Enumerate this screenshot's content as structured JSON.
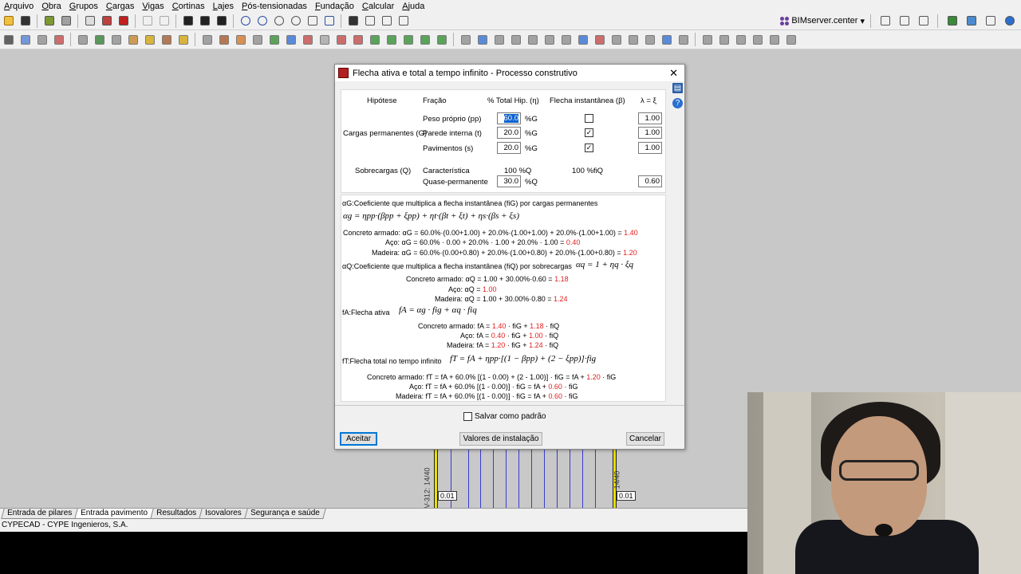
{
  "menu": [
    "Arquivo",
    "Obra",
    "Grupos",
    "Cargas",
    "Vigas",
    "Cortinas",
    "Lajes",
    "Pós-tensionadas",
    "Fundação",
    "Calcular",
    "Ajuda"
  ],
  "bimserver": {
    "label": "BIMserver.center"
  },
  "dialog": {
    "title": "Flecha ativa e total a tempo infinito - Processo construtivo",
    "headers": {
      "hipotese": "Hipótese",
      "fracao": "Fração",
      "total_hip": "% Total Hip. (η)",
      "flecha_inst": "Flecha instantânea (β)",
      "lambda": "λ = ξ"
    },
    "permanentes": {
      "group_label": "Cargas permanentes (G)",
      "rows": [
        {
          "label": "Peso próprio (pp)",
          "pct": "60.0",
          "unit": "%G",
          "checked": false,
          "lambda": "1.00"
        },
        {
          "label": "Parede interna (t)",
          "pct": "20.0",
          "unit": "%G",
          "checked": true,
          "lambda": "1.00"
        },
        {
          "label": "Pavimentos (s)",
          "pct": "20.0",
          "unit": "%G",
          "checked": true,
          "lambda": "1.00"
        }
      ]
    },
    "sobrecargas": {
      "group_label": "Sobrecargas (Q)",
      "caracteristica_label": "Característica",
      "caracteristica_pct": "100 %Q",
      "caracteristica_flecha": "100 %fiQ",
      "quase_label": "Quase-permanente",
      "quase_pct": "30.0",
      "quase_unit": "%Q",
      "quase_lambda": "0.60"
    },
    "formulas": {
      "ag_desc": "αG:Coeficiente que multiplica a flecha instantânea (fiG) por cargas permanentes",
      "ag_formula": "αg = ηpp·(βpp + ξpp) + ηt·(βt + ξt) + ηs·(βs + ξs)",
      "ag_concreto": {
        "prefix": "Concreto armado: αG = 60.0%·(0.00+1.00) + 20.0%·(1.00+1.00) + 20.0%·(1.00+1.00) = ",
        "value": "1.40"
      },
      "ag_aco": {
        "prefix": "Aço: αG = 60.0% · 0.00 + 20.0% · 1.00 + 20.0% · 1.00 = ",
        "value": "0.40"
      },
      "ag_madeira": {
        "prefix": "Madeira: αG = 60.0%·(0.00+0.80) + 20.0%·(1.00+0.80) + 20.0%·(1.00+0.80) = ",
        "value": "1.20"
      },
      "aq_desc": "αQ:Coeficiente que multiplica a flecha instantânea (fiQ) por sobrecargas",
      "aq_formula": "αq = 1 + ηq · ξq",
      "aq_concreto": {
        "prefix": "Concreto armado: αQ = 1.00 + 30.00%·0.60 = ",
        "value": "1.18"
      },
      "aq_aco": {
        "prefix": "Aço: αQ = ",
        "value": "1.00"
      },
      "aq_madeira": {
        "prefix": "Madeira: αQ = 1.00 + 30.00%·0.80 = ",
        "value": "1.24"
      },
      "fa_desc": "fA:Flecha ativa",
      "fa_formula": "fA = αg · fig + αq · fiq",
      "fa_concreto": {
        "prefix": "Concreto armado: fA = ",
        "v1": "1.40",
        "mid": " · fiG + ",
        "v2": "1.18",
        "suffix": " · fiQ"
      },
      "fa_aco": {
        "prefix": "Aço: fA = ",
        "v1": "0.40",
        "mid": " · fiG + ",
        "v2": "1.00",
        "suffix": " · fiQ"
      },
      "fa_madeira": {
        "prefix": "Madeira: fA = ",
        "v1": "1.20",
        "mid": " · fiG + ",
        "v2": "1.24",
        "suffix": " · fiQ"
      },
      "ft_desc": "fT:Flecha total no tempo infinito",
      "ft_formula": "fT = fA + ηpp·[(1 − βpp) + (2 − ξpp)]·fig",
      "ft_concreto": {
        "prefix": "Concreto armado: fT = fA + 60.0% [(1 - 0.00) + (2 - 1.00)] · fiG = fA + ",
        "value": "1.20",
        "suffix": " · fiG"
      },
      "ft_aco": {
        "prefix": "Aço: fT = fA + 60.0% [(1 - 0.00)] · fiG = fA + ",
        "value": "0.60",
        "suffix": " · fiG"
      },
      "ft_madeira": {
        "prefix": "Madeira: fT = fA + 60.0% [(1 - 0.00)] · fiG = fA + ",
        "value": "0.60",
        "suffix": " · fiG"
      }
    },
    "save_default": "Salvar como padrão",
    "buttons": {
      "accept": "Aceitar",
      "defaults": "Valores de instalação",
      "cancel": "Cancelar"
    }
  },
  "drawing": {
    "beam_left": "V-312: 14/40",
    "beam_right": "14/40",
    "val_left": "0.01",
    "val_right": "0.01"
  },
  "bottom_tabs": [
    "Entrada de pilares",
    "Entrada pavimento",
    "Resultados",
    "Isovalores",
    "Segurança e saúde"
  ],
  "active_tab": "Entrada pavimento",
  "status": "CYPECAD - CYPE Ingenieros, S.A."
}
